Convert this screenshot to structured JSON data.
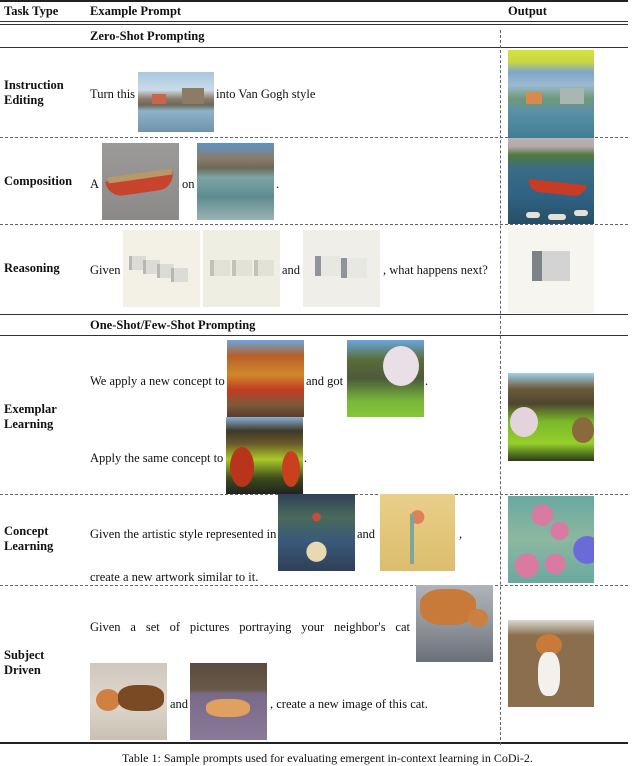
{
  "table": {
    "headers": {
      "task_type": "Task Type",
      "example_prompt": "Example Prompt",
      "output": "Output"
    },
    "sections": [
      {
        "title": "Zero-Shot Prompting"
      },
      {
        "title": "One-Shot/Few-Shot Prompting"
      }
    ],
    "rows": [
      {
        "task": "Instruction Editing",
        "prompt": {
          "t1": "Turn this",
          "t2": "into Van Gogh style"
        },
        "images": [
          "village-by-lake-photo"
        ],
        "output_image": "village-by-lake-van-gogh-style"
      },
      {
        "task": "Composition",
        "prompt": {
          "t1": "A",
          "t2": "on",
          "t3": "."
        },
        "images": [
          "red-rowboat-photo",
          "mountain-lake-photo"
        ],
        "output_image": "rowboat-on-mountain-lake"
      },
      {
        "task": "Reasoning",
        "prompt": {
          "t1": "Given",
          "t2": "and",
          "t3": ", what happens next?"
        },
        "images": [
          "four-cubes",
          "three-cubes",
          "two-cubes"
        ],
        "output_image": "one-cube"
      },
      {
        "task": "Exemplar Learning",
        "prompt": {
          "t1": "We apply a new concept to",
          "t2": "and got",
          "t3": ".",
          "t4": "Apply the same concept to",
          "t5": "."
        },
        "images": [
          "autumn-forest-lake",
          "cherry-blossom-hillside",
          "autumn-valley-fields"
        ],
        "output_image": "blossom-valley-fields"
      },
      {
        "task": "Concept Learning",
        "prompt": {
          "t1": "Given the artistic style represented in",
          "t2": "and",
          "t3": ",",
          "t4": "create a new artwork similar to it."
        },
        "images": [
          "strawberry-thief-pattern",
          "floral-yellow-pattern"
        ],
        "output_image": "new-floral-artwork"
      },
      {
        "task": "Subject Driven",
        "prompt": {
          "t1": "Given a set of pictures portraying your neighbor's cat",
          "t2": "and",
          "t3": ", create a new image of this cat."
        },
        "images": [
          "cat-on-blanket",
          "cat-lying-on-bed",
          "cat-on-deck"
        ],
        "output_image": "cat-sitting-on-carpet"
      }
    ]
  },
  "caption": "Table 1: Sample prompts used for evaluating emergent in-context learning in CoDi-2."
}
